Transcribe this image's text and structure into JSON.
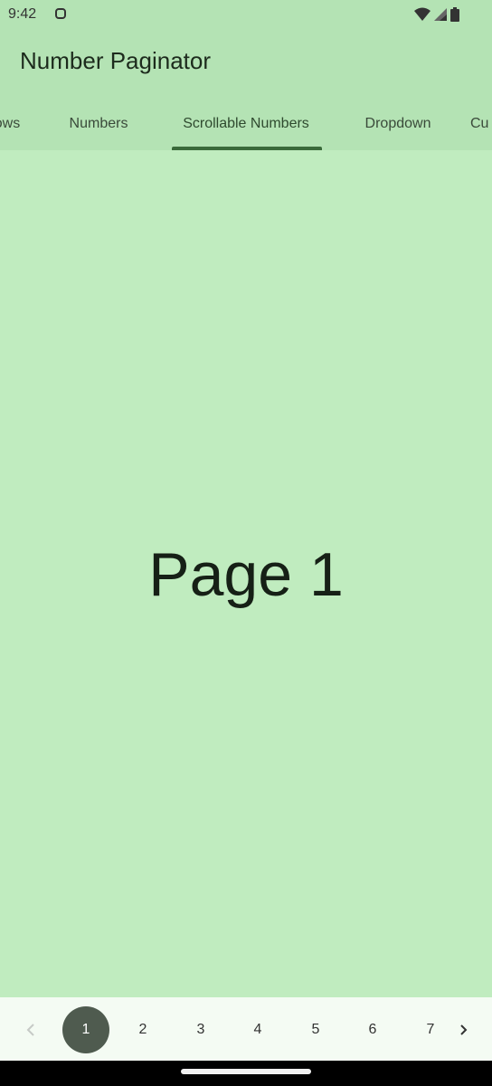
{
  "status_bar": {
    "time": "9:42",
    "icons": [
      "media-icon",
      "wifi-icon",
      "cellular-signal-icon",
      "battery-icon"
    ]
  },
  "app_bar": {
    "title": "Number Paginator"
  },
  "tabs": [
    {
      "label": "Arrows",
      "visible_text": "ows",
      "selected": false
    },
    {
      "label": "Numbers",
      "visible_text": "Numbers",
      "selected": false
    },
    {
      "label": "Scrollable Numbers",
      "visible_text": "Scrollable Numbers",
      "selected": true
    },
    {
      "label": "Dropdown",
      "visible_text": "Dropdown",
      "selected": false
    },
    {
      "label": "Custom",
      "visible_text": "Cu",
      "selected": false
    }
  ],
  "content": {
    "page_label": "Page 1"
  },
  "paginator": {
    "prev_icon": "chevron-left-icon",
    "next_icon": "chevron-right-icon",
    "prev_enabled": false,
    "pages": [
      "1",
      "2",
      "3",
      "4",
      "5",
      "6",
      "7"
    ],
    "current_page": "1"
  },
  "colors": {
    "app_bar": "#b4e3b4",
    "background": "#c0ecbf",
    "active_page": "#4f5b4f",
    "indicator": "#3a6a3a",
    "paginator_bg": "#f4fbf3"
  }
}
